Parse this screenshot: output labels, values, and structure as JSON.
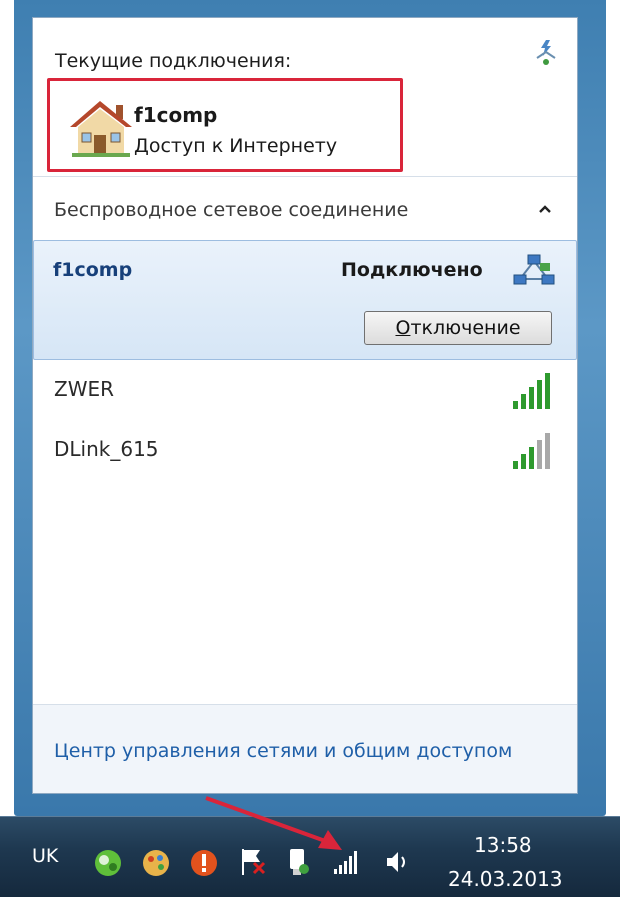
{
  "popup": {
    "current_label": "Текущие подключения:",
    "current": {
      "name": "f1comp",
      "status": "Доступ к Интернету"
    },
    "wireless_header": "Беспроводное сетевое соединение",
    "selected": {
      "name": "f1comp",
      "status": "Подключено",
      "button_accel": "О",
      "button_rest": "тключение"
    },
    "networks": [
      {
        "name": "ZWER",
        "signal_bars": 5
      },
      {
        "name": "DLink_615",
        "signal_bars": 3
      }
    ],
    "footer_link": "Центр управления сетями и общим доступом"
  },
  "taskbar": {
    "language": "UK",
    "time": "13:58",
    "date": "24.03.2013"
  },
  "colors": {
    "highlight_border": "#d9253a",
    "selected_bg": "#d6e6f6",
    "link": "#1f5fa8",
    "signal_on": "#2e9a2e",
    "signal_off": "#a8a8a8"
  }
}
